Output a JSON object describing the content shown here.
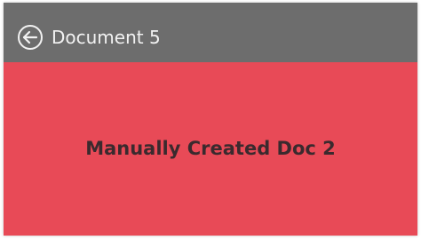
{
  "header": {
    "title": "Document 5",
    "back_icon": "back-arrow-circle-icon",
    "background": "#6d6d6d"
  },
  "main": {
    "text": "Manually Created Doc 2",
    "background": "#e84a57"
  }
}
